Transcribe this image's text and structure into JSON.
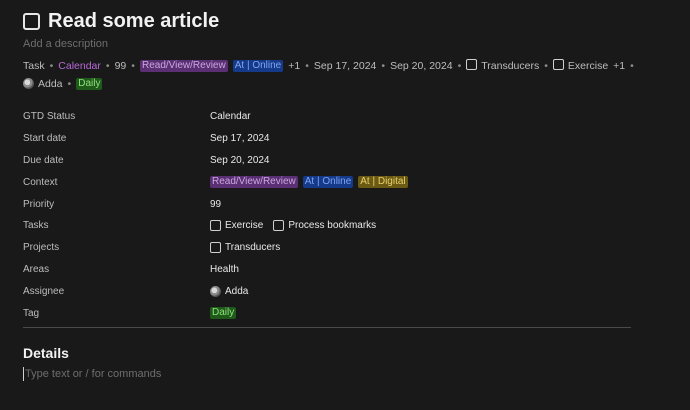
{
  "title": "Read some article",
  "description_placeholder": "Add a description",
  "summary": {
    "type": "Task",
    "status": "Calendar",
    "priority": "99",
    "context_tags": [
      "Read/View/Review",
      "At | Online"
    ],
    "context_more": "+1",
    "start_date": "Sep 17, 2024",
    "due_date": "Sep 20, 2024",
    "project": "Transducers",
    "task": "Exercise",
    "task_more": "+1",
    "assignee": "Adda",
    "tag": "Daily"
  },
  "properties": {
    "gtd_status": {
      "label": "GTD Status",
      "value": "Calendar"
    },
    "start_date": {
      "label": "Start date",
      "value": "Sep 17, 2024"
    },
    "due_date": {
      "label": "Due date",
      "value": "Sep 20, 2024"
    },
    "context": {
      "label": "Context",
      "tags": [
        "Read/View/Review",
        "At | Online",
        "At | Digital"
      ]
    },
    "priority": {
      "label": "Priority",
      "value": "99"
    },
    "tasks": {
      "label": "Tasks",
      "items": [
        "Exercise",
        "Process bookmarks"
      ]
    },
    "projects": {
      "label": "Projects",
      "items": [
        "Transducers"
      ]
    },
    "areas": {
      "label": "Areas",
      "value": "Health"
    },
    "assignee": {
      "label": "Assignee",
      "value": "Adda"
    },
    "tag": {
      "label": "Tag",
      "value": "Daily"
    }
  },
  "details": {
    "heading": "Details",
    "placeholder": "Type text or / for commands"
  },
  "colors": {
    "background": "#191919",
    "status_purple": "#b86ad8",
    "tag_purple": "#5a2f74",
    "tag_blue": "#153a8a",
    "tag_yellow": "#6b5a13",
    "tag_green": "#1f5a1a"
  },
  "icons": [
    "checkbox-icon",
    "avatar-icon"
  ]
}
